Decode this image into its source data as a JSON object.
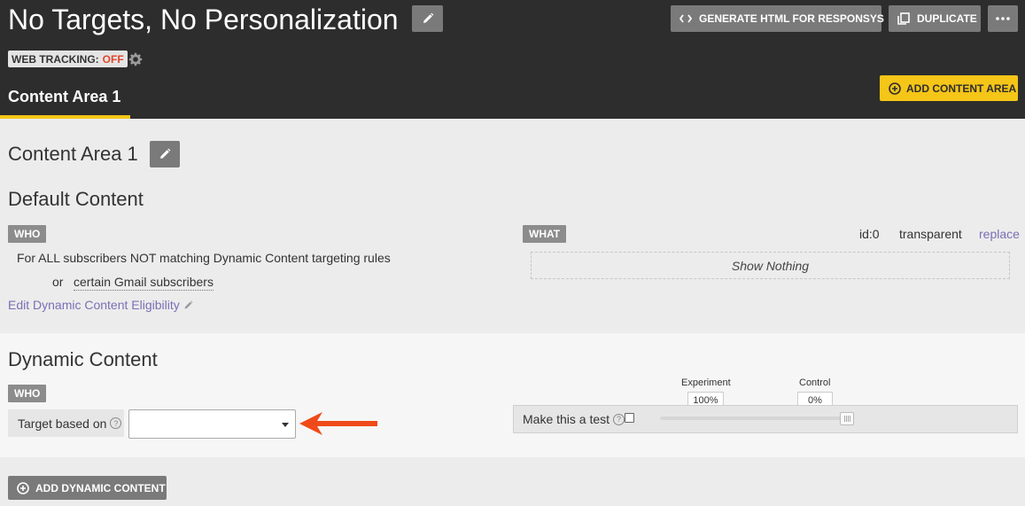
{
  "header": {
    "title": "No Targets, No Personalization",
    "generate_label": "GENERATE HTML FOR RESPONSYS",
    "duplicate_label": "DUPLICATE",
    "web_tracking_label": "WEB TRACKING:",
    "web_tracking_value": "OFF",
    "tab_label": "Content Area 1",
    "add_content_area_label": "ADD CONTENT AREA"
  },
  "content_area": {
    "title": "Content Area 1",
    "default_heading": "Default Content",
    "who_badge": "WHO",
    "rule_text": "For ALL subscribers NOT matching Dynamic Content targeting rules",
    "or_text": "or",
    "gmail_text": "certain Gmail subscribers",
    "edit_eligibility": "Edit Dynamic Content Eligibility",
    "what_badge": "WHAT",
    "id_text": "id:0",
    "transparent_text": "transparent",
    "replace_link": "replace",
    "show_nothing": "Show Nothing"
  },
  "dynamic": {
    "heading": "Dynamic Content",
    "who_badge": "WHO",
    "target_label": "Target based on",
    "target_value": "",
    "test_label": "Make this a test",
    "test_checked": false,
    "experiment_label": "Experiment",
    "experiment_value": "100%",
    "control_label": "Control",
    "control_value": "0%",
    "experiment_fraction": 1.0,
    "add_dynamic_label": "ADD DYNAMIC CONTENT"
  },
  "colors": {
    "header_bg": "#2d2d2d",
    "accent": "#f5c518",
    "link": "#7b6fb5",
    "off": "#e0462a",
    "arrow": "#f04a1a"
  },
  "icons": [
    "pencil-icon",
    "code-icon",
    "copy-icon",
    "ellipsis-icon",
    "gear-icon",
    "plus-circle-icon",
    "help-icon",
    "chevron-down-icon",
    "arrow-left-icon"
  ]
}
